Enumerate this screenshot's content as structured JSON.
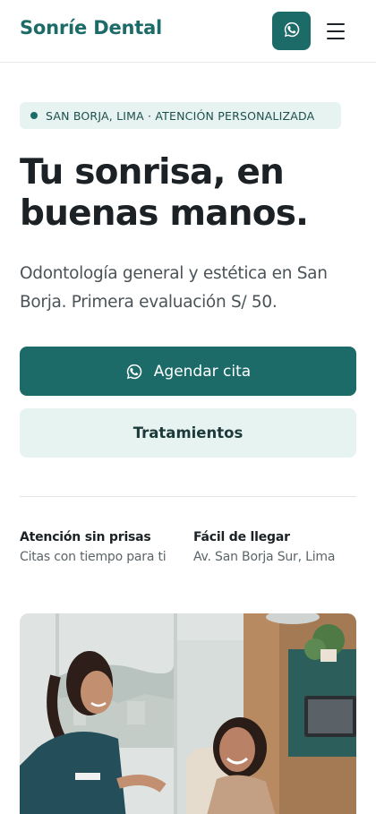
{
  "header": {
    "logo": "Sonríe Dental",
    "whatsapp_icon": "whatsapp-icon",
    "menu_icon": "hamburger-menu-icon"
  },
  "hero": {
    "badge": "SAN BORJA, LIMA · ATENCIÓN PERSONALIZADA",
    "title_line1": "Tu sonrisa, en",
    "title_line2": "buenas manos.",
    "subtitle": "Odontología general y estética en San Borja. Primera evaluación S/ 50.",
    "primary_cta": "Agendar cita",
    "secondary_cta": "Tratamientos"
  },
  "features": [
    {
      "title": "Atención sin prisas",
      "desc": "Citas con tiempo para ti"
    },
    {
      "title": "Fácil de llegar",
      "desc": "Av. San Borja Sur, Lima"
    }
  ],
  "colors": {
    "brand": "#1d6b69",
    "brand_light": "#e6f3f1",
    "text": "#1b2124",
    "muted": "#5b6468"
  }
}
